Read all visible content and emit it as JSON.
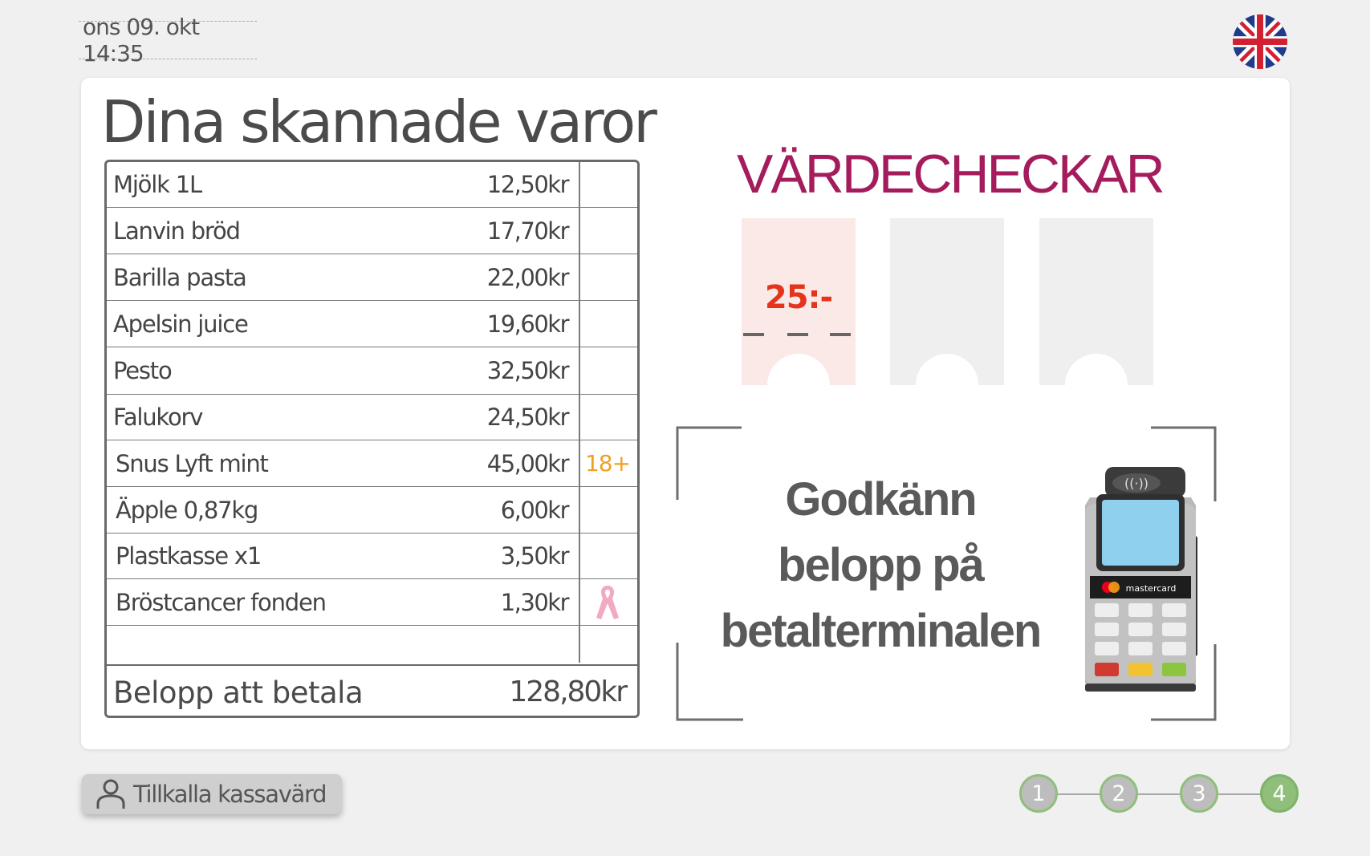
{
  "header": {
    "datetime": "ons 09. okt  14:35",
    "language_flag": "uk-flag-icon"
  },
  "receipt": {
    "title": "Dina skannade varor",
    "items": [
      {
        "name": "Mjölk 1L",
        "price": "12,50kr",
        "flag": ""
      },
      {
        "name": "Lanvin bröd",
        "price": "17,70kr",
        "flag": ""
      },
      {
        "name": "Barilla pasta",
        "price": "22,00kr",
        "flag": ""
      },
      {
        "name": "Apelsin juice",
        "price": "19,60kr",
        "flag": ""
      },
      {
        "name": "Pesto",
        "price": "32,50kr",
        "flag": ""
      },
      {
        "name": "Falukorv",
        "price": "24,50kr",
        "flag": ""
      },
      {
        "name": "Snus Lyft mint",
        "price": "45,00kr",
        "flag": "18+"
      },
      {
        "name": "Äpple 0,87kg",
        "price": "6,00kr",
        "flag": ""
      },
      {
        "name": "Plastkasse x1",
        "price": "3,50kr",
        "flag": ""
      },
      {
        "name": "Bröstcancer fonden",
        "price": "1,30kr",
        "flag": "pink-ribbon-icon"
      }
    ],
    "total_label": "Belopp att betala",
    "total_value": "128,80kr"
  },
  "vouchers": {
    "title": "VÄRDECHECKAR",
    "items": [
      {
        "amount": "25:-",
        "state": "used"
      },
      {
        "amount": "",
        "state": "empty"
      },
      {
        "amount": "",
        "state": "empty"
      }
    ]
  },
  "terminal": {
    "message_line1": "Godkänn",
    "message_line2": "belopp på",
    "message_line3": "betalterminalen",
    "card_brand": "mastercard"
  },
  "footer": {
    "call_button_label": "Tillkalla kassavärd",
    "steps": [
      "1",
      "2",
      "3",
      "4"
    ],
    "active_step": 4
  },
  "colors": {
    "accent_magenta": "#a51c5c",
    "voucher_red": "#e5331c",
    "age_orange": "#f0a020",
    "step_green": "#8fbf7a"
  }
}
